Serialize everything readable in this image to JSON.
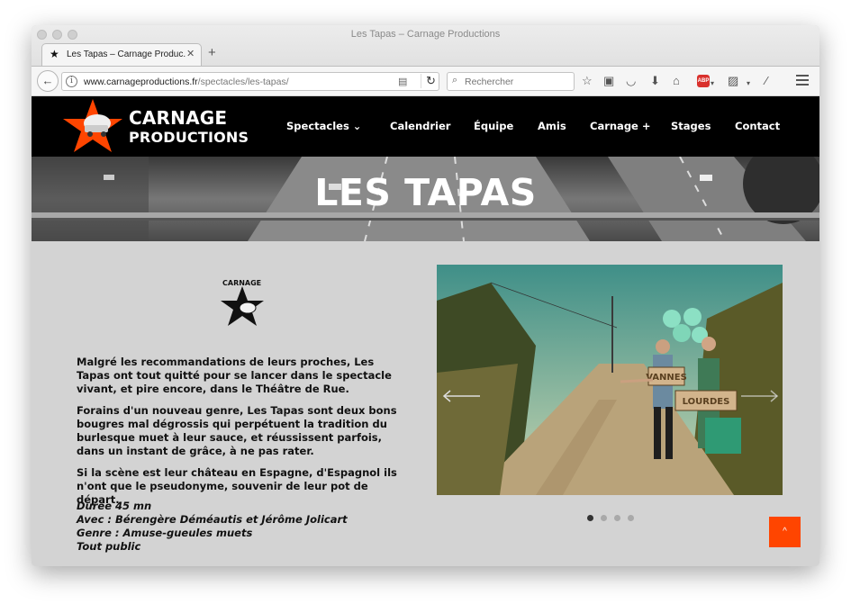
{
  "browser": {
    "window_title": "Les Tapas – Carnage Productions",
    "tab_label": "Les Tapas – Carnage Produc...",
    "tab_close": "✕",
    "new_tab": "+",
    "url_domain": "www.carnageproductions.fr",
    "url_path": "/spectacles/les-tapas/",
    "search_placeholder": "Rechercher",
    "abp_label": "ABP"
  },
  "site": {
    "logo_line1": "CARNAGE",
    "logo_line2": "PRODUCTIONS",
    "nav": [
      {
        "label": "Spectacles ⌄"
      },
      {
        "label": "Calendrier"
      },
      {
        "label": "Équipe"
      },
      {
        "label": "Amis"
      },
      {
        "label": "Carnage +"
      },
      {
        "label": "Stages"
      },
      {
        "label": "Contact"
      }
    ],
    "hero_title": "LES TAPAS"
  },
  "content": {
    "small_logo_text": "CARNAGE",
    "paragraphs": [
      "Malgré les recommandations de leurs proches, Les Tapas ont tout quitté pour se lancer dans le spectacle vivant, et pire encore, dans le Théâtre de Rue.",
      "Forains d'un nouveau genre, Les Tapas sont deux bons bougres mal dégrossis qui perpétuent la tradition du burlesque muet à leur sauce, et réussissent parfois, dans un instant de grâce, à ne pas rater.",
      "Si la scène est leur château en Espagne, d'Espagnol ils n'ont que le pseudonyme, souvenir de leur pot de départ."
    ],
    "info": [
      "Durée 45 mn",
      "Avec : Bérengère Déméautis et Jérôme Jolicart",
      "Genre  : Amuse-gueules muets",
      "Tout public"
    ]
  },
  "slider": {
    "sign1": "VANNES",
    "sign2": "LOURDES",
    "prev": "←",
    "next": "→",
    "dot_count": 4,
    "active_dot": 0
  },
  "scroll_top_label": "^"
}
